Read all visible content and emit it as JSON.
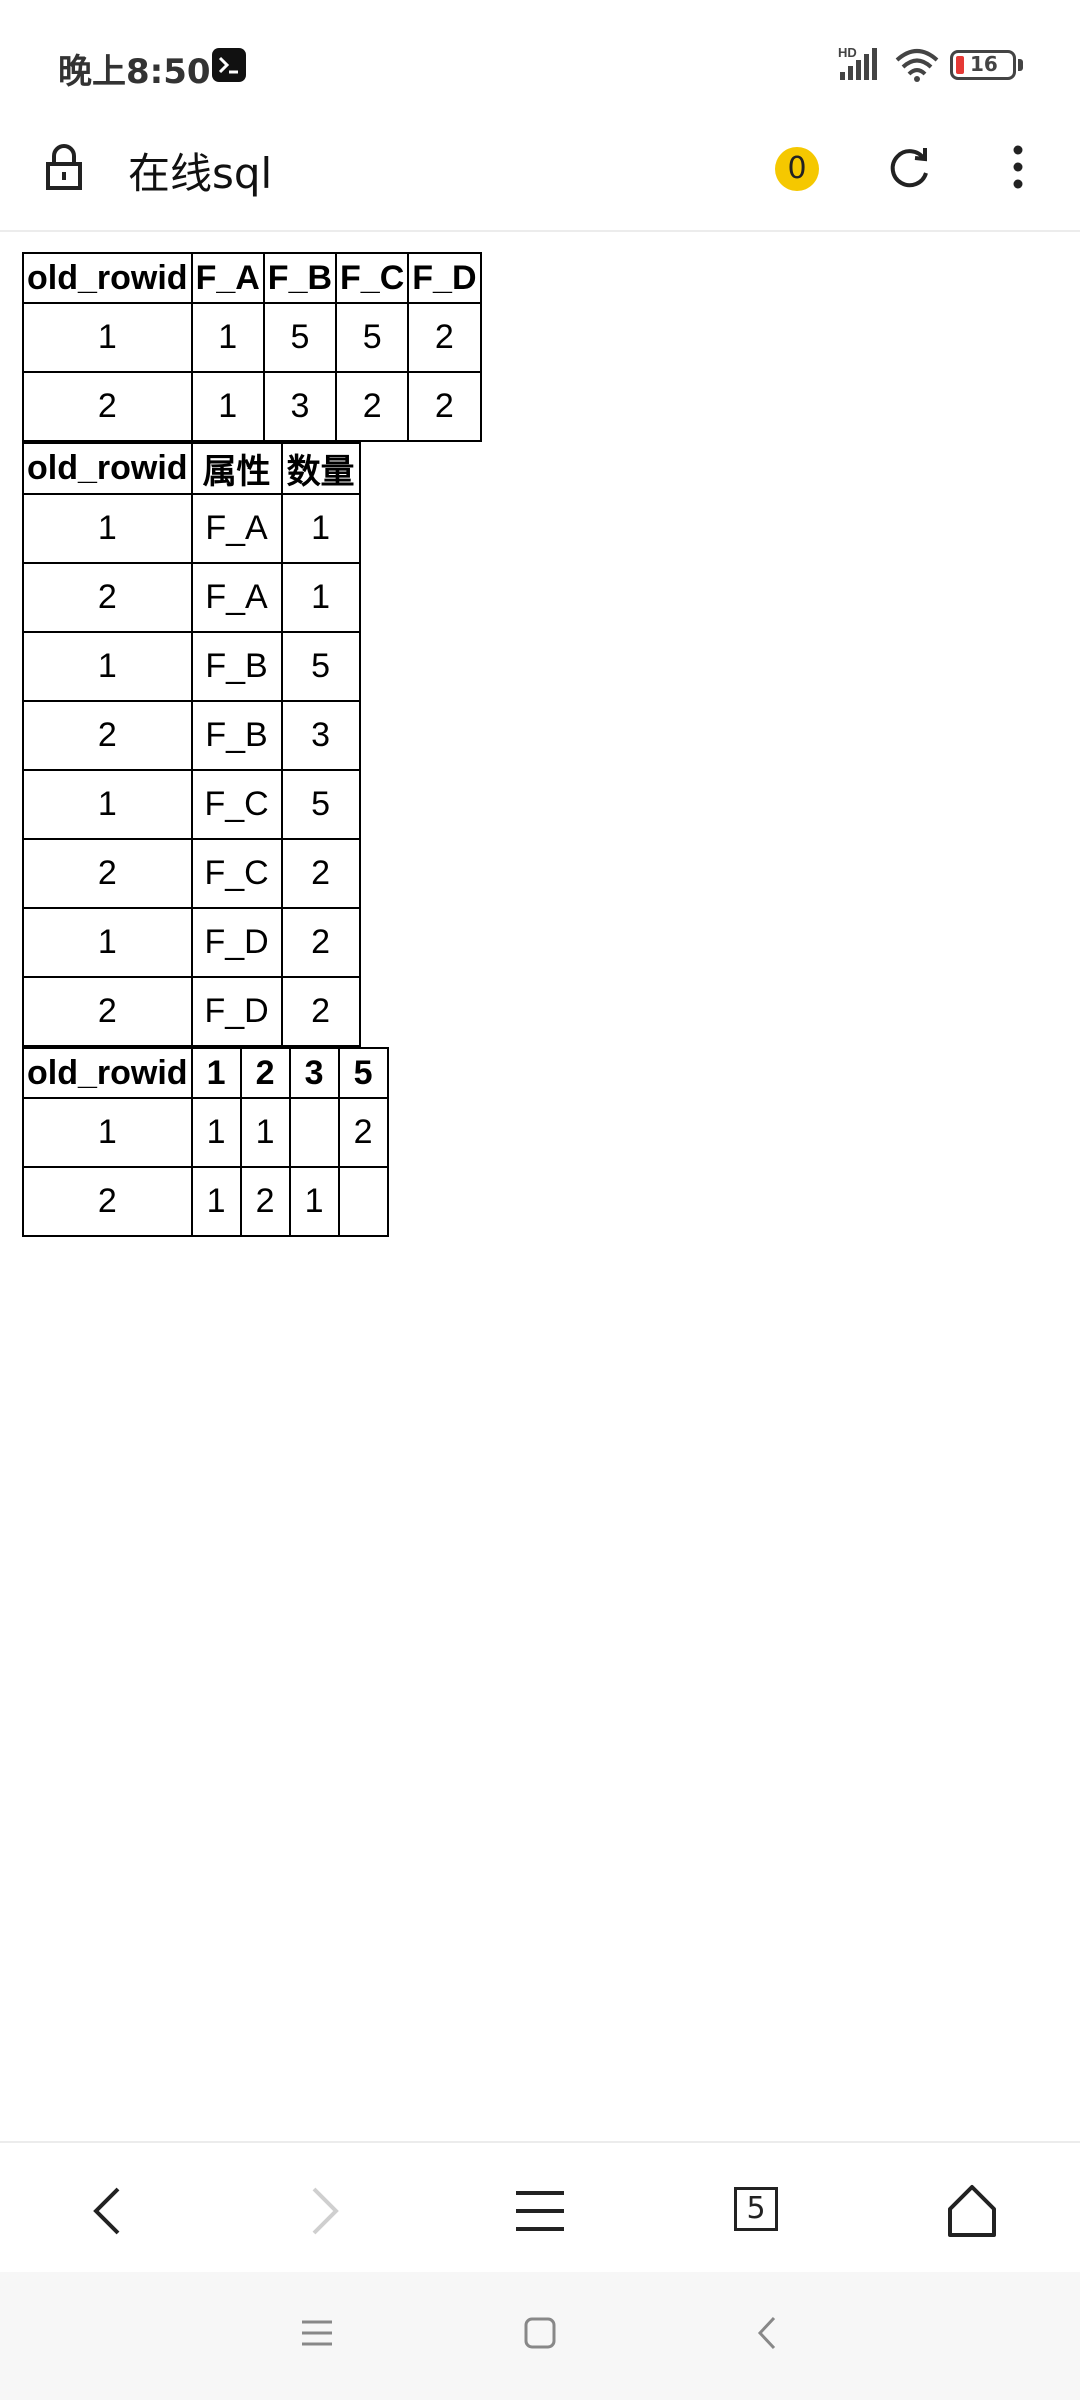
{
  "status_bar": {
    "time": "晚上8:50",
    "battery_level": "16",
    "network_label": "HD"
  },
  "browser": {
    "title": "在线sql",
    "notification_count": "0",
    "tab_count": "5"
  },
  "tables": [
    {
      "headers": [
        "old_rowid",
        "F_A",
        "F_B",
        "F_C",
        "F_D"
      ],
      "rows": [
        [
          "1",
          "1",
          "5",
          "5",
          "2"
        ],
        [
          "2",
          "1",
          "3",
          "2",
          "2"
        ]
      ]
    },
    {
      "headers": [
        "old_rowid",
        "属性",
        "数量"
      ],
      "rows": [
        [
          "1",
          "F_A",
          "1"
        ],
        [
          "2",
          "F_A",
          "1"
        ],
        [
          "1",
          "F_B",
          "5"
        ],
        [
          "2",
          "F_B",
          "3"
        ],
        [
          "1",
          "F_C",
          "5"
        ],
        [
          "2",
          "F_C",
          "2"
        ],
        [
          "1",
          "F_D",
          "2"
        ],
        [
          "2",
          "F_D",
          "2"
        ]
      ]
    },
    {
      "headers": [
        "old_rowid",
        "1",
        "2",
        "3",
        "5"
      ],
      "rows": [
        [
          "1",
          "1",
          "1",
          "",
          "2"
        ],
        [
          "2",
          "1",
          "2",
          "1",
          ""
        ]
      ]
    }
  ],
  "colors": {
    "badge": "#f5c800",
    "battery_low": "#e53935"
  }
}
